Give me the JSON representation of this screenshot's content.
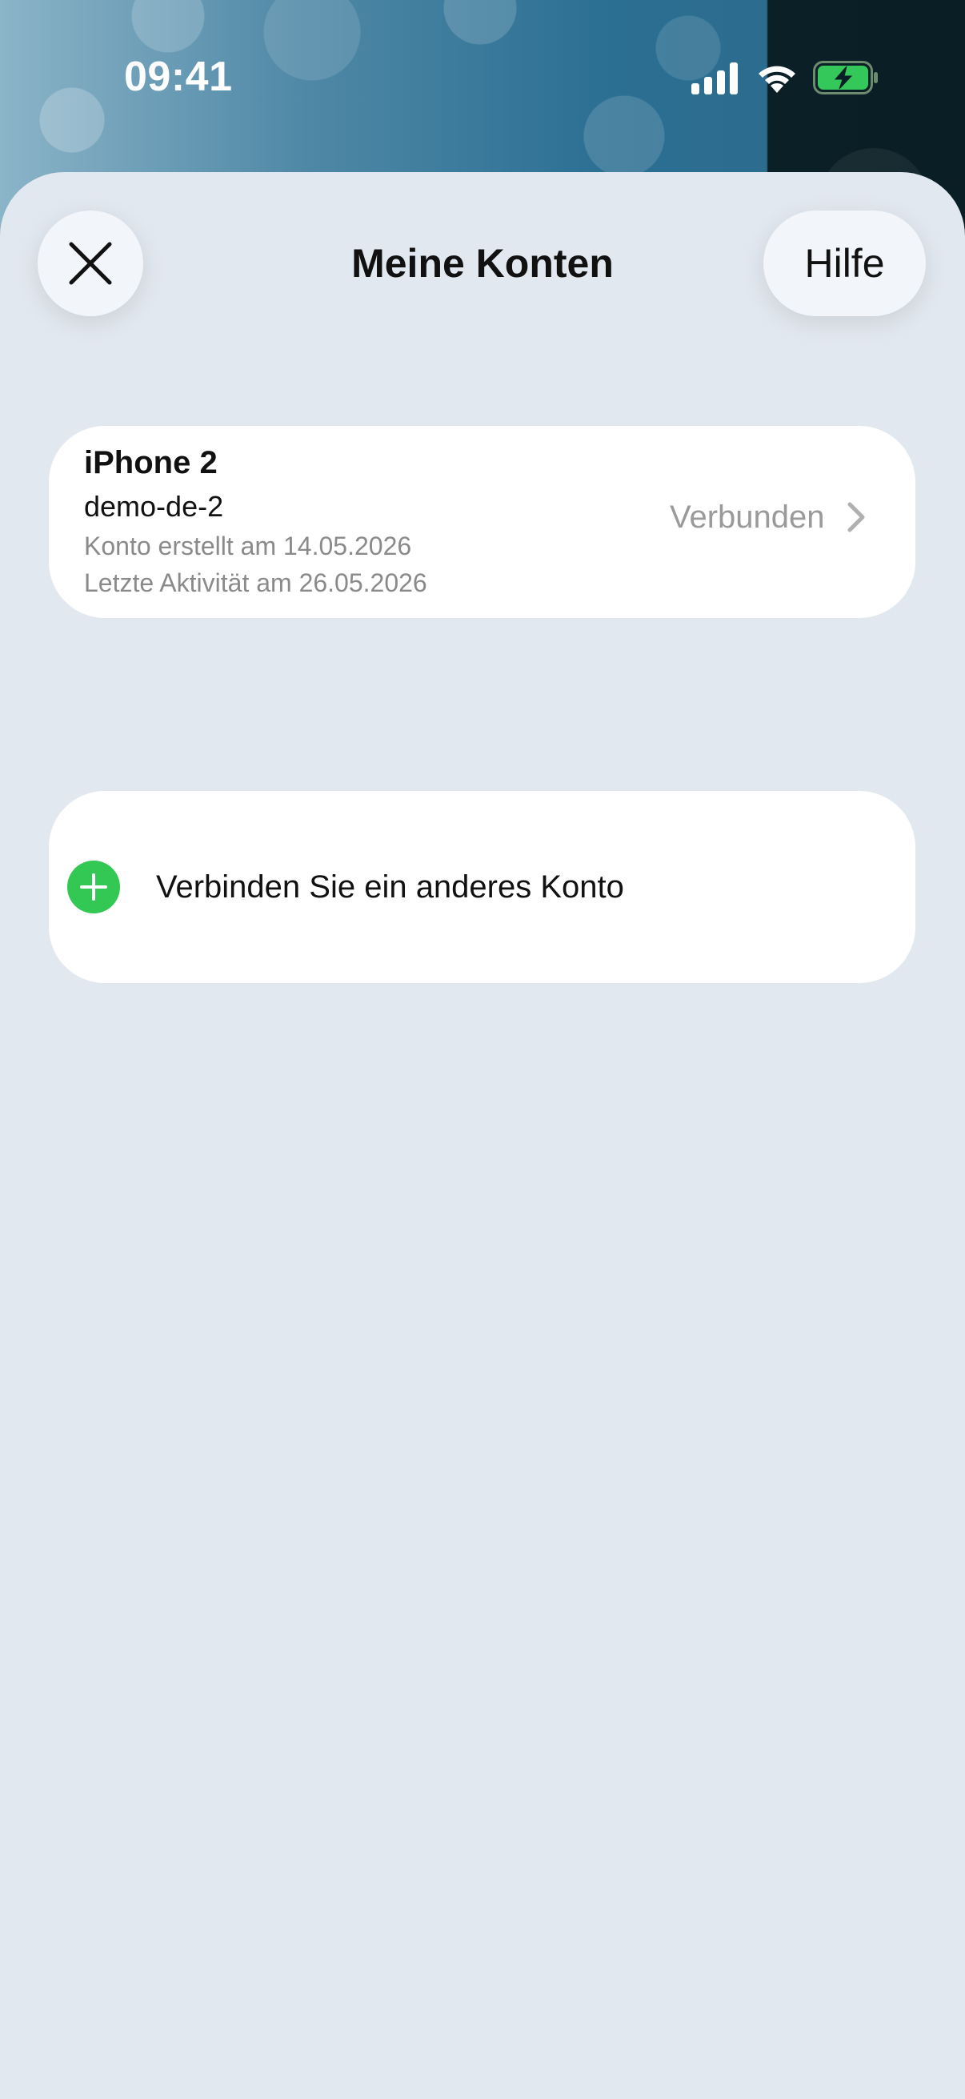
{
  "status_bar": {
    "time": "09:41",
    "icons": [
      "signal-icon",
      "wifi-icon",
      "battery-charging-icon"
    ],
    "battery_color": "#34c759"
  },
  "header": {
    "title": "Meine Konten",
    "close_icon": "close-icon",
    "help_label": "Hilfe"
  },
  "account": {
    "name": "iPhone 2",
    "username": "demo-de-2",
    "created": "Konto erstellt am 14.05.2026",
    "last_activity": "Letzte Aktivität am 26.05.2026",
    "status": "Verbunden",
    "chevron_icon": "chevron-right-icon"
  },
  "add_account": {
    "label": "Verbinden Sie ein anderes Konto",
    "icon": "plus-icon",
    "icon_color": "#33c754"
  }
}
